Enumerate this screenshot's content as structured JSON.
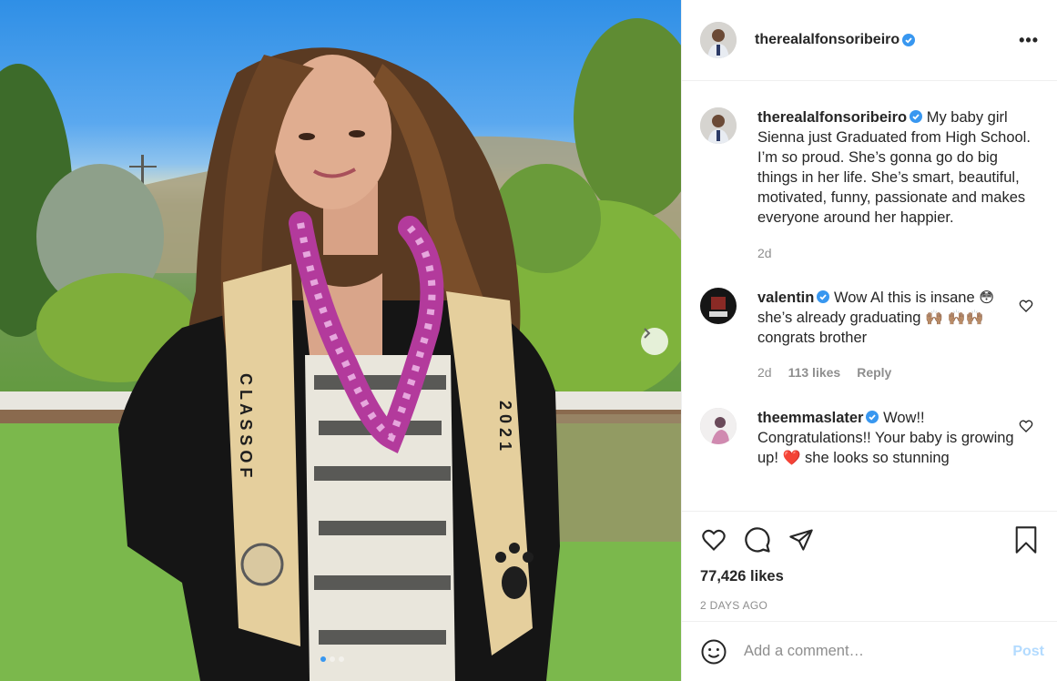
{
  "post": {
    "username": "therealalfonsoribeiro",
    "more_label": "•••",
    "caption": "My baby girl Sienna just Graduated from High School. I’m so proud. She’s gonna go do big things in her life. She’s smart, beautiful, motivated, funny, passionate and makes everyone around her happier.",
    "caption_age": "2d",
    "likes": "77,426 likes",
    "date": "2 DAYS AGO",
    "carousel_count": 3,
    "carousel_active": 0
  },
  "photo": {
    "stole_left_text": "CLASS OF",
    "stole_right_text": "2021"
  },
  "comments": [
    {
      "username": "valentin",
      "text_1": "Wow Al this is insane",
      "emoji_1": "😳",
      "text_2": "she’s already graduating",
      "emoji_2": "🙌🏽",
      "emoji_3": "🙌🏽🙌🏽",
      "text_3": "congrats brother",
      "age": "2d",
      "likes": "113 likes",
      "reply": "Reply"
    },
    {
      "username": "theemmaslater",
      "text_1": "Wow!! Congratulations!! Your baby is growing up!",
      "emoji_1": "❤️",
      "text_2": "she looks so stunning"
    }
  ],
  "add_comment": {
    "placeholder": "Add a comment…",
    "post_label": "Post"
  },
  "colors": {
    "verified": "#3897f0",
    "post_disabled": "#b3dbff",
    "muted": "#8e8e8e"
  },
  "icons": [
    "verified-icon",
    "heart-icon",
    "comment-icon",
    "share-icon",
    "bookmark-icon",
    "emoji-icon",
    "chevron-right-icon"
  ]
}
